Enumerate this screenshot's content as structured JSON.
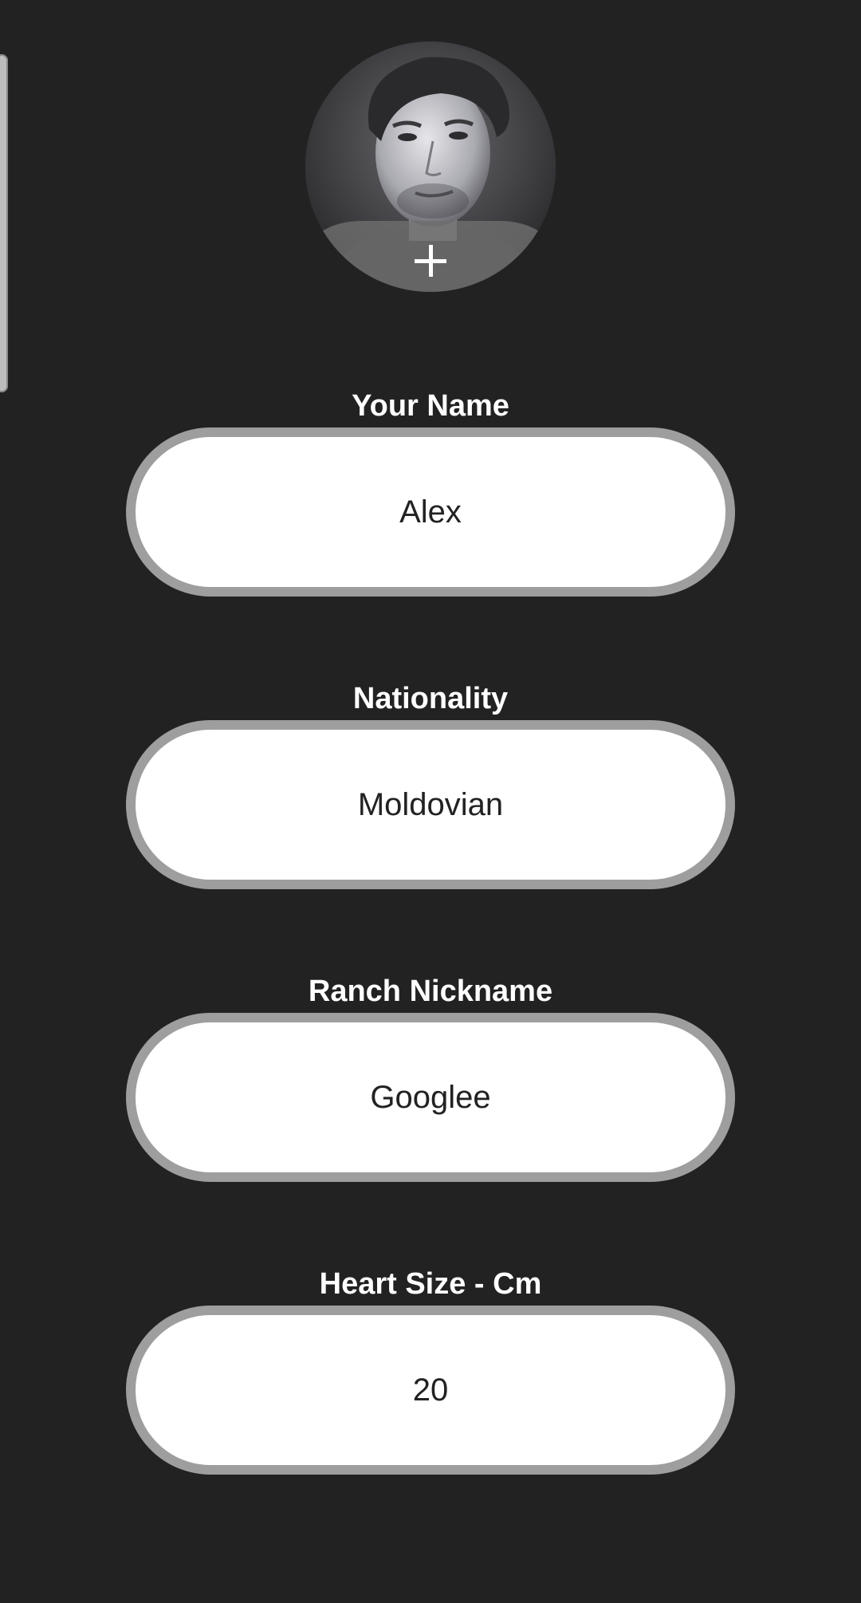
{
  "profile": {
    "avatar_alt": "Profile photo",
    "add_photo_icon": "plus-icon"
  },
  "fields": [
    {
      "label": "Your Name",
      "value": "Alex"
    },
    {
      "label": "Nationality",
      "value": "Moldovian"
    },
    {
      "label": "Ranch Nickname",
      "value": "Googlee"
    },
    {
      "label": "Heart Size - Cm",
      "value": "20"
    }
  ],
  "colors": {
    "background": "#222222",
    "field_border": "#9e9e9e",
    "field_fill": "#ffffff",
    "label_text": "#ffffff"
  }
}
